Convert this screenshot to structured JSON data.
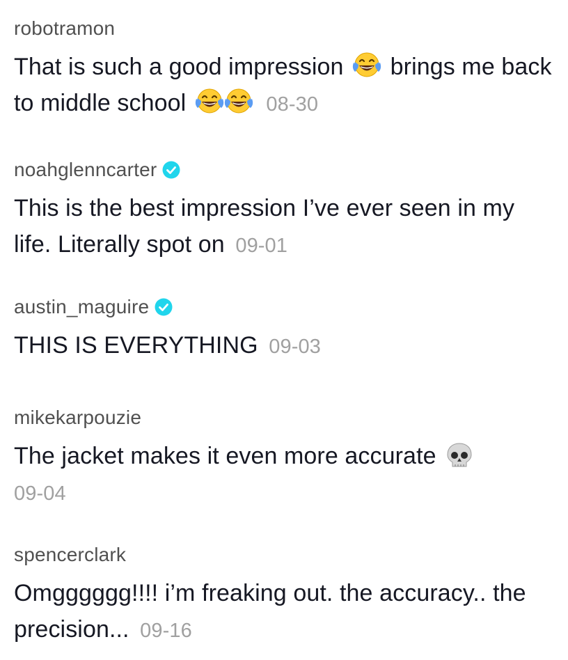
{
  "comments": [
    {
      "username": "robotramon",
      "verified": false,
      "text_part1": "That is such a good impression",
      "emoji1": "joy-emoji",
      "text_part2": "brings me back to middle school",
      "emoji2": "joy-emoji",
      "emoji3": "joy-emoji",
      "date": "08-30"
    },
    {
      "username": "noahglenncarter",
      "verified": true,
      "text": "This is the best impression I’ve ever seen in my life. Literally spot on",
      "date": "09-01"
    },
    {
      "username": "austin_maguire",
      "verified": true,
      "text": "THIS IS EVERYTHING",
      "date": "09-03"
    },
    {
      "username": "mikekarpouzie",
      "verified": false,
      "text": "The jacket makes it even more accurate",
      "emoji": "skull-emoji",
      "date": "09-04"
    },
    {
      "username": "spencerclark",
      "verified": false,
      "text": "Omgggggg!!!! i’m freaking out. the accuracy.. the precision...",
      "date": "09-16"
    }
  ],
  "colors": {
    "username": "#505050",
    "text": "#161823",
    "date": "#a0a0a0",
    "verified_badge": "#20d5ec",
    "emoji_face": "#ffcc33",
    "emoji_tears": "#5b9cf2"
  }
}
